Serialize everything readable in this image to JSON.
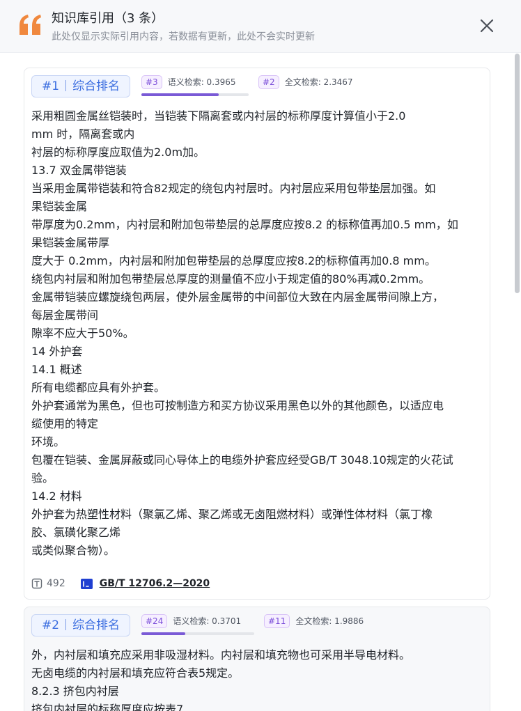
{
  "header": {
    "title": "知识库引用（3 条）",
    "subtitle": "此处仅显示实际引用内容，若数据有更新，此处不会实时更新",
    "quote_icon": "quote-icon",
    "close_icon": "close-icon",
    "accent_color": "#f0883e"
  },
  "cards": [
    {
      "rank_num": "#1",
      "rank_label": "综合排名",
      "semantic": {
        "badge": "#3",
        "label": "语义检索: 0.3965",
        "progress": 0.72
      },
      "fulltext": {
        "badge": "#2",
        "label": "全文检索: 2.3467"
      },
      "lines": [
        "采用粗圆金属丝铠装时，当铠装下隔离套或内衬层的标称厚度计算值小于2.0",
        "mm 时，隔离套或内",
        "衬层的标称厚度应取值为2.0m加。",
        "13.7 双金属带铠装",
        "当采用金属带铠装和符合82规定的绕包内衬层时。内衬层应采用包带垫层加强。如",
        "果铠装金属",
        "带厚度为0.2mm，内衬层和附加包带垫层的总厚度应按8.2 的标称值再加0.5 mm，如",
        "果铠装金属带厚",
        "度大于 0.2mm，内衬层和附加包带垫层的总厚度应按8.2的标称值再加0.8 mm。",
        "绕包内衬层和附加包带垫层总厚度的测量值不应小于规定值的80%再减0.2mm。",
        "金属带铠装应螺旋绕包两层，使外层金属带的中间部位大致在内层金属带间隙上方，",
        "每层金属带间",
        "隙率不应大于50%。",
        "14 外护套",
        "14.1 概述",
        "所有电缆都应具有外护套。",
        "外护套通常为黑色，但也可按制造方和买方协议采用黑色以外的其他颜色，以适应电",
        "缆使用的特定",
        "环境。",
        "包覆在铠装、金属屏蔽或同心导体上的电缆外护套应经受GB/T 3048.10规定的火花试",
        "验。",
        "14.2 材料",
        "外护套为热塑性材料（聚氯乙烯、聚乙烯或无卤阻燃材料）或弹性体材料（氯丁橡",
        "胶、氯磺化聚乙烯",
        "或类似聚合物）。"
      ],
      "tokens": "492",
      "source": "GB/T 12706.2—2020"
    },
    {
      "rank_num": "#2",
      "rank_label": "综合排名",
      "semantic": {
        "badge": "#24",
        "label": "语义检索: 0.3701",
        "progress": 0.39
      },
      "fulltext": {
        "badge": "#11",
        "label": "全文检索: 1.9886"
      },
      "lines": [
        "外，内衬层和填充应采用非吸湿材料。内衬层和填充物也可采用半导电材料。",
        "无卤电缆的内衬层和填充应符合表5规定。",
        "8.2.3 挤包内衬层",
        "挤包内衬层的标称厚度应按表7"
      ]
    }
  ]
}
